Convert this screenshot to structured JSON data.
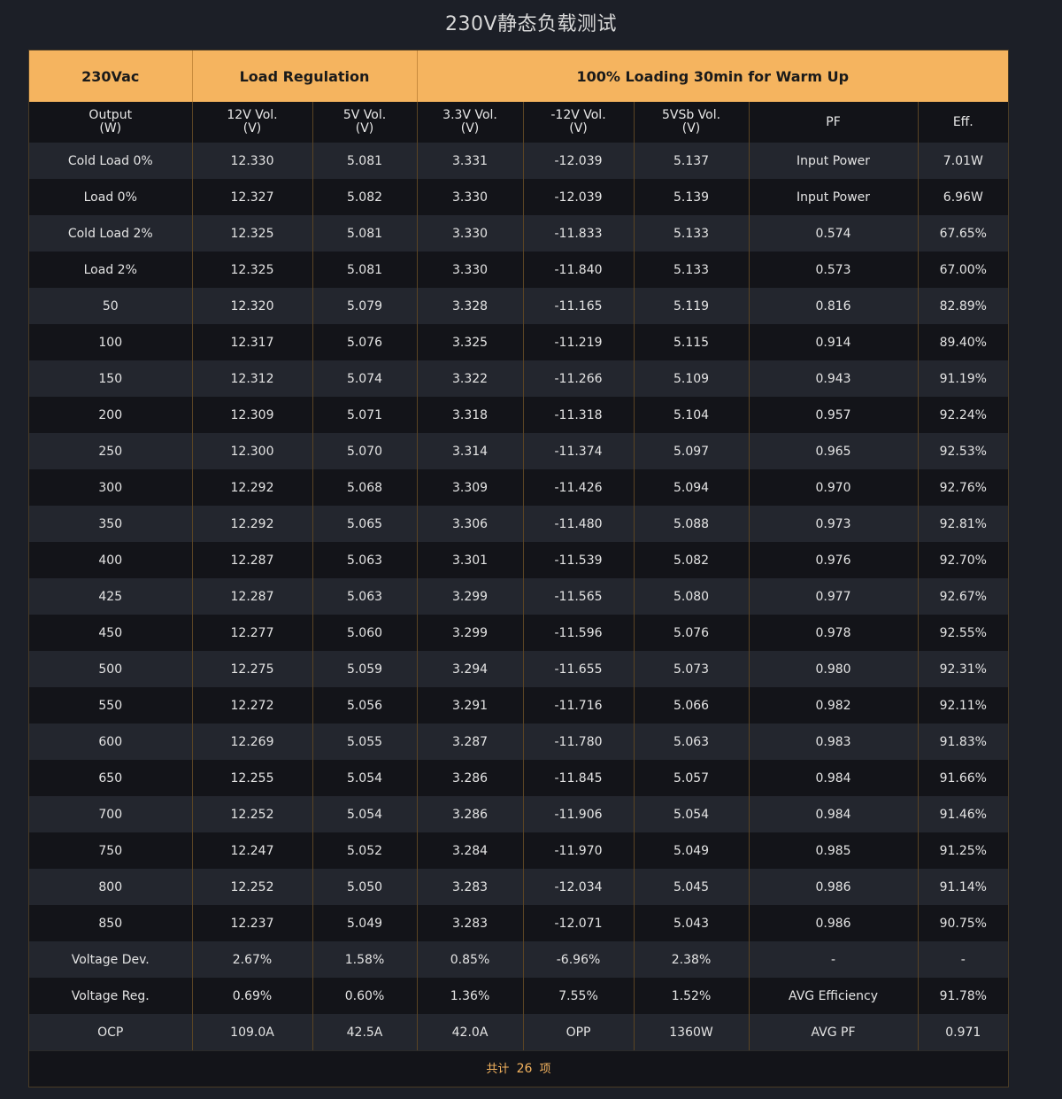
{
  "title": "230V静态负载测试",
  "group_headers": [
    "230Vac",
    "Load Regulation",
    "100% Loading 30min for Warm Up"
  ],
  "columns": [
    {
      "name": "Output",
      "unit": "(W)"
    },
    {
      "name": "12V Vol.",
      "unit": "(V)"
    },
    {
      "name": "5V Vol.",
      "unit": "(V)"
    },
    {
      "name": "3.3V Vol.",
      "unit": "(V)"
    },
    {
      "name": "-12V Vol.",
      "unit": "(V)"
    },
    {
      "name": "5VSb Vol.",
      "unit": "(V)"
    },
    {
      "name": "PF",
      "unit": ""
    },
    {
      "name": "Eff.",
      "unit": ""
    }
  ],
  "rows": [
    [
      "Cold Load 0%",
      "12.330",
      "5.081",
      "3.331",
      "-12.039",
      "5.137",
      "Input Power",
      "7.01W"
    ],
    [
      "Load 0%",
      "12.327",
      "5.082",
      "3.330",
      "-12.039",
      "5.139",
      "Input Power",
      "6.96W"
    ],
    [
      "Cold Load 2%",
      "12.325",
      "5.081",
      "3.330",
      "-11.833",
      "5.133",
      "0.574",
      "67.65%"
    ],
    [
      "Load 2%",
      "12.325",
      "5.081",
      "3.330",
      "-11.840",
      "5.133",
      "0.573",
      "67.00%"
    ],
    [
      "50",
      "12.320",
      "5.079",
      "3.328",
      "-11.165",
      "5.119",
      "0.816",
      "82.89%"
    ],
    [
      "100",
      "12.317",
      "5.076",
      "3.325",
      "-11.219",
      "5.115",
      "0.914",
      "89.40%"
    ],
    [
      "150",
      "12.312",
      "5.074",
      "3.322",
      "-11.266",
      "5.109",
      "0.943",
      "91.19%"
    ],
    [
      "200",
      "12.309",
      "5.071",
      "3.318",
      "-11.318",
      "5.104",
      "0.957",
      "92.24%"
    ],
    [
      "250",
      "12.300",
      "5.070",
      "3.314",
      "-11.374",
      "5.097",
      "0.965",
      "92.53%"
    ],
    [
      "300",
      "12.292",
      "5.068",
      "3.309",
      "-11.426",
      "5.094",
      "0.970",
      "92.76%"
    ],
    [
      "350",
      "12.292",
      "5.065",
      "3.306",
      "-11.480",
      "5.088",
      "0.973",
      "92.81%"
    ],
    [
      "400",
      "12.287",
      "5.063",
      "3.301",
      "-11.539",
      "5.082",
      "0.976",
      "92.70%"
    ],
    [
      "425",
      "12.287",
      "5.063",
      "3.299",
      "-11.565",
      "5.080",
      "0.977",
      "92.67%"
    ],
    [
      "450",
      "12.277",
      "5.060",
      "3.299",
      "-11.596",
      "5.076",
      "0.978",
      "92.55%"
    ],
    [
      "500",
      "12.275",
      "5.059",
      "3.294",
      "-11.655",
      "5.073",
      "0.980",
      "92.31%"
    ],
    [
      "550",
      "12.272",
      "5.056",
      "3.291",
      "-11.716",
      "5.066",
      "0.982",
      "92.11%"
    ],
    [
      "600",
      "12.269",
      "5.055",
      "3.287",
      "-11.780",
      "5.063",
      "0.983",
      "91.83%"
    ],
    [
      "650",
      "12.255",
      "5.054",
      "3.286",
      "-11.845",
      "5.057",
      "0.984",
      "91.66%"
    ],
    [
      "700",
      "12.252",
      "5.054",
      "3.286",
      "-11.906",
      "5.054",
      "0.984",
      "91.46%"
    ],
    [
      "750",
      "12.247",
      "5.052",
      "3.284",
      "-11.970",
      "5.049",
      "0.985",
      "91.25%"
    ],
    [
      "800",
      "12.252",
      "5.050",
      "3.283",
      "-12.034",
      "5.045",
      "0.986",
      "91.14%"
    ],
    [
      "850",
      "12.237",
      "5.049",
      "3.283",
      "-12.071",
      "5.043",
      "0.986",
      "90.75%"
    ],
    [
      "Voltage Dev.",
      "2.67%",
      "1.58%",
      "0.85%",
      "-6.96%",
      "2.38%",
      "-",
      "-"
    ],
    [
      "Voltage Reg.",
      "0.69%",
      "0.60%",
      "1.36%",
      "7.55%",
      "1.52%",
      "AVG Efficiency",
      "91.78%"
    ],
    [
      "OCP",
      "109.0A",
      "42.5A",
      "42.0A",
      "OPP",
      "1360W",
      "AVG PF",
      "0.971"
    ]
  ],
  "footer": {
    "prefix": "共计",
    "count": "26",
    "suffix": "项"
  },
  "colors": {
    "header_bg": "#f5b45f",
    "accent": "#f5b45f",
    "page_bg": "#1c1f27",
    "row_odd": "#23262e",
    "row_even": "#131419"
  }
}
